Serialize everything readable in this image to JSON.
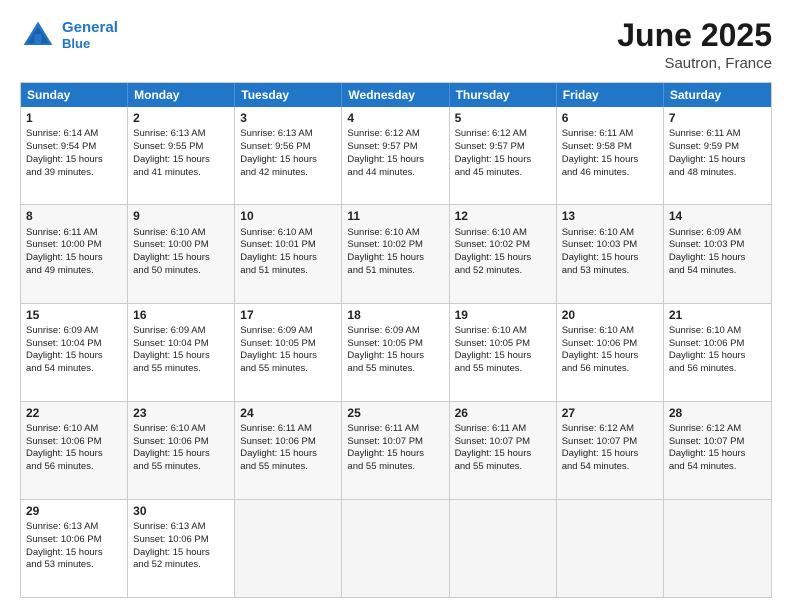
{
  "logo": {
    "line1": "General",
    "line2": "Blue"
  },
  "title": "June 2025",
  "subtitle": "Sautron, France",
  "header_days": [
    "Sunday",
    "Monday",
    "Tuesday",
    "Wednesday",
    "Thursday",
    "Friday",
    "Saturday"
  ],
  "rows": [
    [
      {
        "day": "1",
        "lines": [
          "Sunrise: 6:14 AM",
          "Sunset: 9:54 PM",
          "Daylight: 15 hours",
          "and 39 minutes."
        ]
      },
      {
        "day": "2",
        "lines": [
          "Sunrise: 6:13 AM",
          "Sunset: 9:55 PM",
          "Daylight: 15 hours",
          "and 41 minutes."
        ]
      },
      {
        "day": "3",
        "lines": [
          "Sunrise: 6:13 AM",
          "Sunset: 9:56 PM",
          "Daylight: 15 hours",
          "and 42 minutes."
        ]
      },
      {
        "day": "4",
        "lines": [
          "Sunrise: 6:12 AM",
          "Sunset: 9:57 PM",
          "Daylight: 15 hours",
          "and 44 minutes."
        ]
      },
      {
        "day": "5",
        "lines": [
          "Sunrise: 6:12 AM",
          "Sunset: 9:57 PM",
          "Daylight: 15 hours",
          "and 45 minutes."
        ]
      },
      {
        "day": "6",
        "lines": [
          "Sunrise: 6:11 AM",
          "Sunset: 9:58 PM",
          "Daylight: 15 hours",
          "and 46 minutes."
        ]
      },
      {
        "day": "7",
        "lines": [
          "Sunrise: 6:11 AM",
          "Sunset: 9:59 PM",
          "Daylight: 15 hours",
          "and 48 minutes."
        ]
      }
    ],
    [
      {
        "day": "8",
        "lines": [
          "Sunrise: 6:11 AM",
          "Sunset: 10:00 PM",
          "Daylight: 15 hours",
          "and 49 minutes."
        ]
      },
      {
        "day": "9",
        "lines": [
          "Sunrise: 6:10 AM",
          "Sunset: 10:00 PM",
          "Daylight: 15 hours",
          "and 50 minutes."
        ]
      },
      {
        "day": "10",
        "lines": [
          "Sunrise: 6:10 AM",
          "Sunset: 10:01 PM",
          "Daylight: 15 hours",
          "and 51 minutes."
        ]
      },
      {
        "day": "11",
        "lines": [
          "Sunrise: 6:10 AM",
          "Sunset: 10:02 PM",
          "Daylight: 15 hours",
          "and 51 minutes."
        ]
      },
      {
        "day": "12",
        "lines": [
          "Sunrise: 6:10 AM",
          "Sunset: 10:02 PM",
          "Daylight: 15 hours",
          "and 52 minutes."
        ]
      },
      {
        "day": "13",
        "lines": [
          "Sunrise: 6:10 AM",
          "Sunset: 10:03 PM",
          "Daylight: 15 hours",
          "and 53 minutes."
        ]
      },
      {
        "day": "14",
        "lines": [
          "Sunrise: 6:09 AM",
          "Sunset: 10:03 PM",
          "Daylight: 15 hours",
          "and 54 minutes."
        ]
      }
    ],
    [
      {
        "day": "15",
        "lines": [
          "Sunrise: 6:09 AM",
          "Sunset: 10:04 PM",
          "Daylight: 15 hours",
          "and 54 minutes."
        ]
      },
      {
        "day": "16",
        "lines": [
          "Sunrise: 6:09 AM",
          "Sunset: 10:04 PM",
          "Daylight: 15 hours",
          "and 55 minutes."
        ]
      },
      {
        "day": "17",
        "lines": [
          "Sunrise: 6:09 AM",
          "Sunset: 10:05 PM",
          "Daylight: 15 hours",
          "and 55 minutes."
        ]
      },
      {
        "day": "18",
        "lines": [
          "Sunrise: 6:09 AM",
          "Sunset: 10:05 PM",
          "Daylight: 15 hours",
          "and 55 minutes."
        ]
      },
      {
        "day": "19",
        "lines": [
          "Sunrise: 6:10 AM",
          "Sunset: 10:05 PM",
          "Daylight: 15 hours",
          "and 55 minutes."
        ]
      },
      {
        "day": "20",
        "lines": [
          "Sunrise: 6:10 AM",
          "Sunset: 10:06 PM",
          "Daylight: 15 hours",
          "and 56 minutes."
        ]
      },
      {
        "day": "21",
        "lines": [
          "Sunrise: 6:10 AM",
          "Sunset: 10:06 PM",
          "Daylight: 15 hours",
          "and 56 minutes."
        ]
      }
    ],
    [
      {
        "day": "22",
        "lines": [
          "Sunrise: 6:10 AM",
          "Sunset: 10:06 PM",
          "Daylight: 15 hours",
          "and 56 minutes."
        ]
      },
      {
        "day": "23",
        "lines": [
          "Sunrise: 6:10 AM",
          "Sunset: 10:06 PM",
          "Daylight: 15 hours",
          "and 55 minutes."
        ]
      },
      {
        "day": "24",
        "lines": [
          "Sunrise: 6:11 AM",
          "Sunset: 10:06 PM",
          "Daylight: 15 hours",
          "and 55 minutes."
        ]
      },
      {
        "day": "25",
        "lines": [
          "Sunrise: 6:11 AM",
          "Sunset: 10:07 PM",
          "Daylight: 15 hours",
          "and 55 minutes."
        ]
      },
      {
        "day": "26",
        "lines": [
          "Sunrise: 6:11 AM",
          "Sunset: 10:07 PM",
          "Daylight: 15 hours",
          "and 55 minutes."
        ]
      },
      {
        "day": "27",
        "lines": [
          "Sunrise: 6:12 AM",
          "Sunset: 10:07 PM",
          "Daylight: 15 hours",
          "and 54 minutes."
        ]
      },
      {
        "day": "28",
        "lines": [
          "Sunrise: 6:12 AM",
          "Sunset: 10:07 PM",
          "Daylight: 15 hours",
          "and 54 minutes."
        ]
      }
    ],
    [
      {
        "day": "29",
        "lines": [
          "Sunrise: 6:13 AM",
          "Sunset: 10:06 PM",
          "Daylight: 15 hours",
          "and 53 minutes."
        ]
      },
      {
        "day": "30",
        "lines": [
          "Sunrise: 6:13 AM",
          "Sunset: 10:06 PM",
          "Daylight: 15 hours",
          "and 52 minutes."
        ]
      },
      {
        "day": "",
        "lines": []
      },
      {
        "day": "",
        "lines": []
      },
      {
        "day": "",
        "lines": []
      },
      {
        "day": "",
        "lines": []
      },
      {
        "day": "",
        "lines": []
      }
    ]
  ]
}
